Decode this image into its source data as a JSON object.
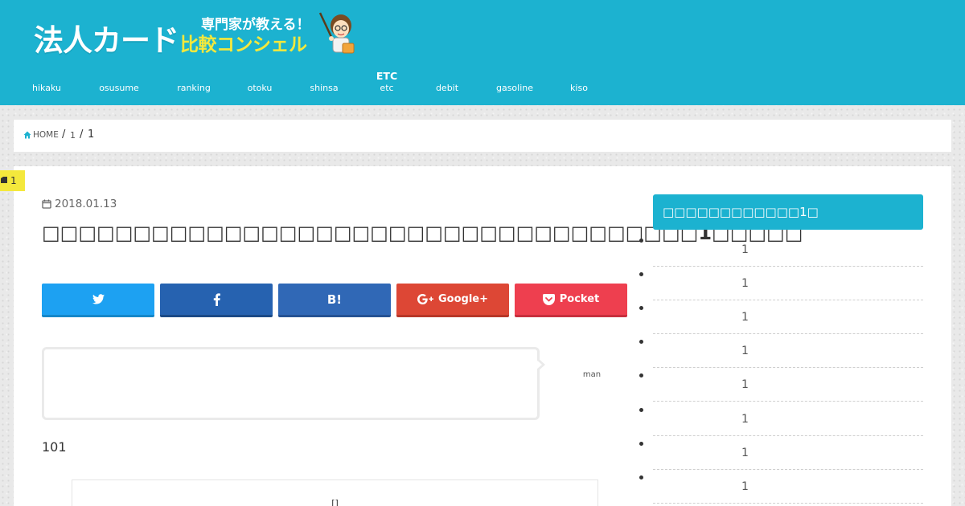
{
  "header": {
    "logo_main": "法人カード",
    "logo_tagline": "専門家が教える！",
    "logo_sub": "比較コンシェル",
    "nav": [
      {
        "big": "",
        "label": "hikaku"
      },
      {
        "big": "",
        "label": "osusume"
      },
      {
        "big": "",
        "label": "ranking"
      },
      {
        "big": "",
        "label": "otoku"
      },
      {
        "big": "",
        "label": "shinsa"
      },
      {
        "big": "ETC",
        "label": "etc"
      },
      {
        "big": "",
        "label": "debit"
      },
      {
        "big": "",
        "label": "gasoline"
      },
      {
        "big": "",
        "label": "kiso"
      }
    ]
  },
  "breadcrumb": {
    "home": "HOME",
    "sep": "/",
    "level1": "1",
    "current": "1"
  },
  "article": {
    "category_badge": "1",
    "date": "2018.01.13",
    "title": "□□□□□□□□□□□□□□□□□□□□□□□□□□□□□□□□□□□□1□□□□□",
    "share": {
      "twitter_icon": "twitter-icon",
      "facebook_icon": "facebook-icon",
      "hatena_label": "B!",
      "google_label": "Google+",
      "pocket_label": "Pocket"
    },
    "balloon_name": "man",
    "body_text": "101",
    "toc_title": "[]"
  },
  "sidebar": {
    "title": "□□□□□□□□□□□□1□",
    "items": [
      "1",
      "1",
      "1",
      "1",
      "1",
      "1",
      "1",
      "1"
    ]
  },
  "colors": {
    "brand": "#1cb2d0",
    "accent_yellow": "#f4e83c",
    "twitter": "#1da1f2",
    "facebook": "#2662b0",
    "hatena": "#3068b6",
    "google": "#dd4735",
    "pocket": "#ee3f4f"
  }
}
